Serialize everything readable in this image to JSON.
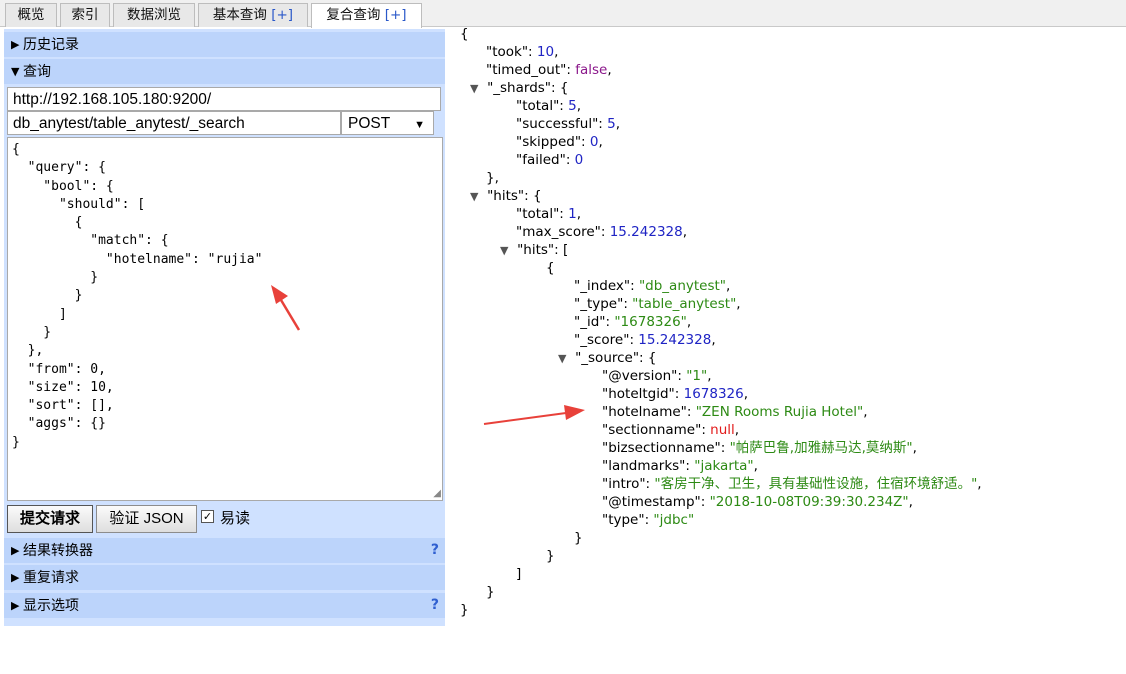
{
  "tabs": [
    {
      "label": "概览",
      "plus": ""
    },
    {
      "label": "索引",
      "plus": ""
    },
    {
      "label": "数据浏览",
      "plus": ""
    },
    {
      "label": "基本查询 ",
      "plus": "[+]"
    },
    {
      "label": "复合查询 ",
      "plus": "[+]"
    }
  ],
  "left": {
    "history_label": "历史记录",
    "query_label": "查询",
    "url_value": "http://192.168.105.180:9200/",
    "path_value": "db_anytest/table_anytest/_search",
    "method_value": "POST",
    "query_body": "{\n  \"query\": {\n    \"bool\": {\n      \"should\": [\n        {\n          \"match\": {\n            \"hotelname\": \"rujia\"\n          }\n        }\n      ]\n    }\n  },\n  \"from\": 0,\n  \"size\": 10,\n  \"sort\": [],\n  \"aggs\": {}\n}",
    "submit_label": "提交请求",
    "validate_label": "验证 JSON",
    "pretty_label": "易读",
    "pretty_checked": true,
    "result_transformer_label": "结果转换器",
    "repeat_label": "重复请求",
    "display_options_label": "显示选项",
    "help_glyph": "?"
  },
  "result_lines": [
    {
      "indent": 0,
      "toggle": "",
      "key": "",
      "value": "{",
      "vtype": "",
      "trail": ""
    },
    {
      "indent": 1,
      "toggle": "",
      "key": "\"took\": ",
      "value": "10",
      "vtype": "num",
      "trail": ","
    },
    {
      "indent": 1,
      "toggle": "",
      "key": "\"timed_out\": ",
      "value": "false",
      "vtype": "bool",
      "trail": ","
    },
    {
      "indent": 1,
      "toggle": "▼",
      "key": "\"_shards\": ",
      "value": "{",
      "vtype": "",
      "trail": ""
    },
    {
      "indent": 2,
      "toggle": "",
      "key": "\"total\": ",
      "value": "5",
      "vtype": "num",
      "trail": ","
    },
    {
      "indent": 2,
      "toggle": "",
      "key": "\"successful\": ",
      "value": "5",
      "vtype": "num",
      "trail": ","
    },
    {
      "indent": 2,
      "toggle": "",
      "key": "\"skipped\": ",
      "value": "0",
      "vtype": "num",
      "trail": ","
    },
    {
      "indent": 2,
      "toggle": "",
      "key": "\"failed\": ",
      "value": "0",
      "vtype": "num",
      "trail": ""
    },
    {
      "indent": 1,
      "toggle": "",
      "key": "",
      "value": "},",
      "vtype": "",
      "trail": ""
    },
    {
      "indent": 1,
      "toggle": "▼",
      "key": "\"hits\": ",
      "value": "{",
      "vtype": "",
      "trail": ""
    },
    {
      "indent": 2,
      "toggle": "",
      "key": "\"total\": ",
      "value": "1",
      "vtype": "num",
      "trail": ","
    },
    {
      "indent": 2,
      "toggle": "",
      "key": "\"max_score\": ",
      "value": "15.242328",
      "vtype": "num",
      "trail": ","
    },
    {
      "indent": 2,
      "toggle": "▼",
      "key": "\"hits\": ",
      "value": "[",
      "vtype": "",
      "trail": ""
    },
    {
      "indent": 3,
      "toggle": "",
      "key": "",
      "value": "{",
      "vtype": "",
      "trail": ""
    },
    {
      "indent": 4,
      "toggle": "",
      "key": "\"_index\": ",
      "value": "\"db_anytest\"",
      "vtype": "str",
      "trail": ","
    },
    {
      "indent": 4,
      "toggle": "",
      "key": "\"_type\": ",
      "value": "\"table_anytest\"",
      "vtype": "str",
      "trail": ","
    },
    {
      "indent": 4,
      "toggle": "",
      "key": "\"_id\": ",
      "value": "\"1678326\"",
      "vtype": "str",
      "trail": ","
    },
    {
      "indent": 4,
      "toggle": "",
      "key": "\"_score\": ",
      "value": "15.242328",
      "vtype": "num",
      "trail": ","
    },
    {
      "indent": 4,
      "toggle": "▼",
      "key": "\"_source\": ",
      "value": "{",
      "vtype": "",
      "trail": ""
    },
    {
      "indent": 5,
      "toggle": "",
      "key": "\"@version\": ",
      "value": "\"1\"",
      "vtype": "str",
      "trail": ","
    },
    {
      "indent": 5,
      "toggle": "",
      "key": "\"hoteltgid\": ",
      "value": "1678326",
      "vtype": "num",
      "trail": ","
    },
    {
      "indent": 5,
      "toggle": "",
      "key": "\"hotelname\": ",
      "value": "\"ZEN Rooms Rujia Hotel\"",
      "vtype": "str",
      "trail": ","
    },
    {
      "indent": 5,
      "toggle": "",
      "key": "\"sectionname\": ",
      "value": "null",
      "vtype": "null",
      "trail": ","
    },
    {
      "indent": 5,
      "toggle": "",
      "key": "\"bizsectionname\": ",
      "value": "\"帕萨巴鲁,加雅赫马达,莫纳斯\"",
      "vtype": "str",
      "trail": ","
    },
    {
      "indent": 5,
      "toggle": "",
      "key": "\"landmarks\": ",
      "value": "\"jakarta\"",
      "vtype": "str",
      "trail": ","
    },
    {
      "indent": 5,
      "toggle": "",
      "key": "\"intro\": ",
      "value": "\"客房干净、卫生，具有基础性设施，住宿环境舒适。\"",
      "vtype": "str",
      "trail": ","
    },
    {
      "indent": 5,
      "toggle": "",
      "key": "\"@timestamp\": ",
      "value": "\"2018-10-08T09:39:30.234Z\"",
      "vtype": "str",
      "trail": ","
    },
    {
      "indent": 5,
      "toggle": "",
      "key": "\"type\": ",
      "value": "\"jdbc\"",
      "vtype": "str",
      "trail": ""
    },
    {
      "indent": 4,
      "toggle": "",
      "key": "",
      "value": "}",
      "vtype": "",
      "trail": ""
    },
    {
      "indent": 3,
      "toggle": "",
      "key": "",
      "value": "}",
      "vtype": "",
      "trail": ""
    },
    {
      "indent": 2,
      "toggle": "",
      "key": "",
      "value": "]",
      "vtype": "",
      "trail": ""
    },
    {
      "indent": 1,
      "toggle": "",
      "key": "",
      "value": "}",
      "vtype": "",
      "trail": ""
    },
    {
      "indent": 0,
      "toggle": "",
      "key": "",
      "value": "}",
      "vtype": "",
      "trail": ""
    }
  ],
  "colors": {
    "number": "#1f24c4",
    "string": "#2d8a14",
    "bool": "#8b188b",
    "null": "#e21b1b",
    "annotation_arrow": "#e8413a"
  }
}
